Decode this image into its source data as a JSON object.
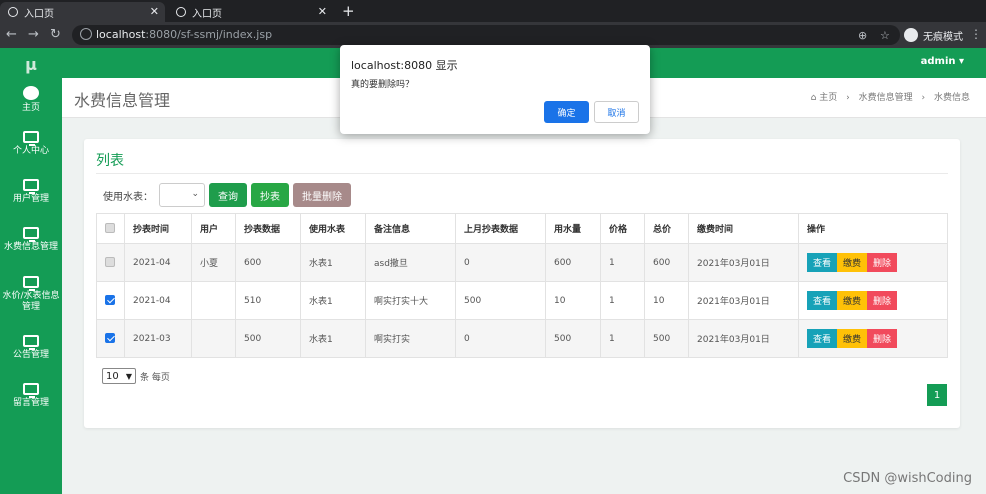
{
  "browser": {
    "tabs": [
      {
        "label": "入口页"
      },
      {
        "label": "入口页"
      }
    ],
    "url_host": "localhost",
    "url_path": ":8080/sf-ssmj/index.jsp",
    "incognito_label": "无痕模式"
  },
  "app": {
    "logo": "μ",
    "user": "admin ▾",
    "sidebar": [
      {
        "label": "主页",
        "icon": "dashboard-icon"
      },
      {
        "label": "个人中心",
        "icon": "monitor-icon"
      },
      {
        "label": "用户管理",
        "icon": "monitor-icon"
      },
      {
        "label": "水费信息管理",
        "icon": "monitor-icon"
      },
      {
        "label": "水价/水表信息管理",
        "icon": "monitor-icon"
      },
      {
        "label": "公告管理",
        "icon": "monitor-icon"
      },
      {
        "label": "留言管理",
        "icon": "monitor-icon"
      }
    ],
    "page_title": "水费信息管理",
    "breadcrumb": [
      "主页",
      "水费信息管理",
      "水费信息"
    ]
  },
  "list": {
    "title": "列表",
    "filter_label": "使用水表：",
    "filter_value": "",
    "buttons": {
      "query": "查询",
      "read_meter": "抄表",
      "batch_delete": "批量删除"
    },
    "columns": [
      "抄表时间",
      "用户",
      "抄表数据",
      "使用水表",
      "备注信息",
      "上月抄表数据",
      "用水量",
      "价格",
      "总价",
      "缴费时间",
      "操作"
    ],
    "rows": [
      {
        "checked": false,
        "cells": [
          "2021-04",
          "小夏",
          "600",
          "水表1",
          "asd撒旦",
          "0",
          "600",
          "1",
          "600",
          "2021年03月01日"
        ]
      },
      {
        "checked": true,
        "cells": [
          "2021-04",
          "",
          "510",
          "水表1",
          "啊实打实十大",
          "500",
          "10",
          "1",
          "10",
          "2021年03月01日"
        ]
      },
      {
        "checked": true,
        "cells": [
          "2021-03",
          "",
          "500",
          "水表1",
          "啊实打实",
          "0",
          "500",
          "1",
          "500",
          "2021年03月01日"
        ]
      }
    ],
    "actions": {
      "view": "查看",
      "pay": "缴费",
      "delete": "删除"
    },
    "page_size": "10",
    "page_size_suffix": "条 每页",
    "current_page": "1"
  },
  "dialog": {
    "title": "localhost:8080 显示",
    "message": "真的要删除吗？",
    "ok": "确定",
    "cancel": "取消"
  },
  "watermark": "CSDN @wishCoding"
}
